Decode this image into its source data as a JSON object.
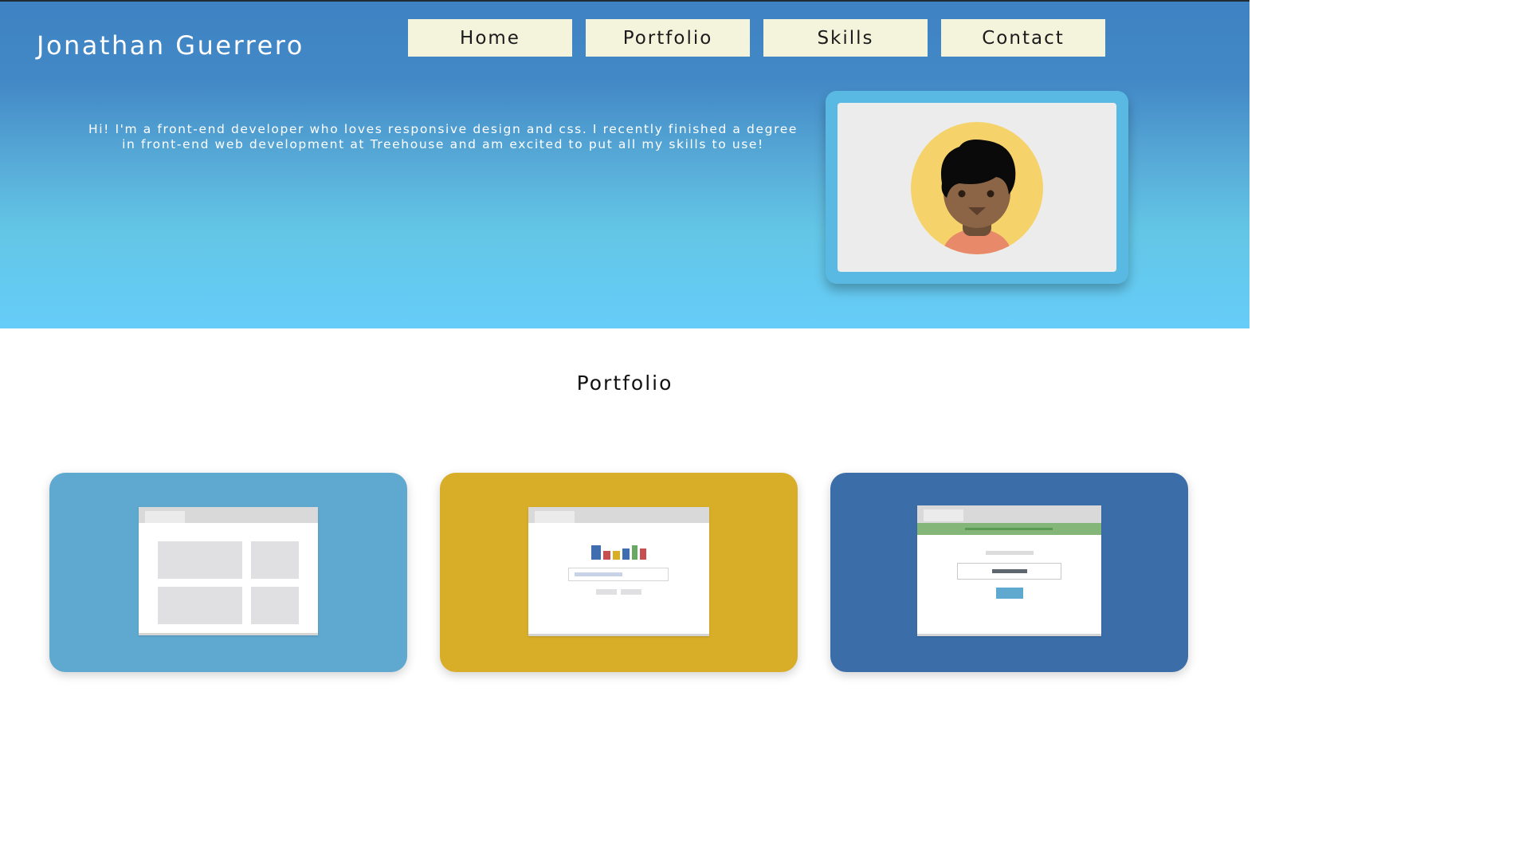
{
  "header": {
    "brand": "Jonathan Guerrero",
    "nav": [
      "Home",
      "Portfolio",
      "Skills",
      "Contact"
    ]
  },
  "hero": {
    "intro": "Hi! I'm a front-end developer who loves responsive design and css. I recently finished a degree in front-end web development at Treehouse and am excited to put all my skills to use!"
  },
  "avatar": {
    "icon": "avatar-illustration-icon"
  },
  "portfolio": {
    "title": "Portfolio",
    "cards": [
      {
        "color": "#5fa8cf",
        "icon": "layout-grid-page-icon"
      },
      {
        "color": "#d8ae28",
        "icon": "chart-form-page-icon"
      },
      {
        "color": "#3b6da8",
        "icon": "login-form-page-icon"
      }
    ]
  },
  "colors": {
    "nav_button": "#f4f4dd",
    "hero_top": "#3f82c3",
    "hero_bottom": "#66cdf9"
  }
}
